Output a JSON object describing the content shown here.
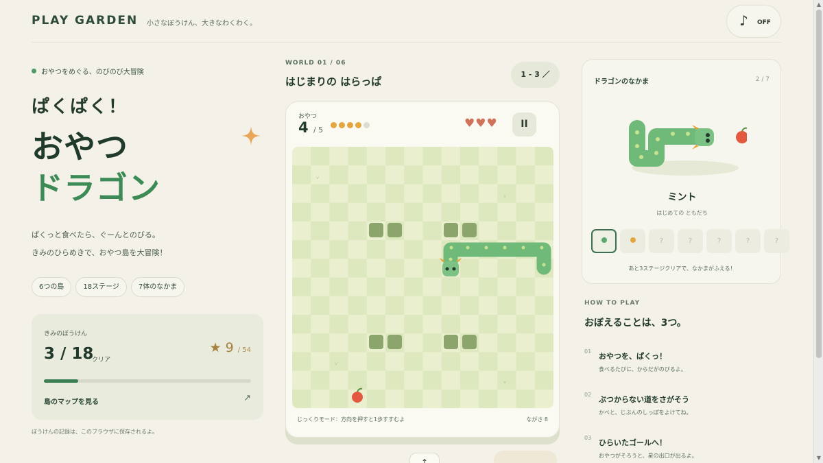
{
  "header": {
    "brand": "PLAY GARDEN",
    "tagline": "小さなぼうけん、大きなわくわく。",
    "sound_label": "OFF",
    "sound_icon": "music-note-icon"
  },
  "hero": {
    "lead": "おやつをめぐる、のびのび大冒険",
    "title_small": "ぱくぱく！",
    "title_line1": "おやつ",
    "title_line2": "ドラゴン",
    "desc_line1": "ぱくっと食べたら、ぐーんとのびる。",
    "desc_line2": "きみのひらめきで、おやつ島を大冒険！",
    "pills": [
      "6つの島",
      "18ステージ",
      "7体のなかま"
    ]
  },
  "progress": {
    "label": "きみのぼうけん",
    "cleared": "3 / 18",
    "cleared_value": 3,
    "cleared_total": 18,
    "clear_word": "クリア",
    "stars": "9",
    "stars_total": "/ 54",
    "map_link": "島のマップを見る",
    "save_note": "ぼうけんの記録は、このブラウザに保存されるよ。"
  },
  "game": {
    "world_label": "WORLD 01 / 06",
    "world_title": "はじまりの はらっぱ",
    "stage_button": "1 - 3 ／",
    "snack_label": "おやつ",
    "snack_count": "4",
    "snack_total": "/ 5",
    "snack_progress": [
      true,
      true,
      true,
      true,
      false
    ],
    "lives": "♥♥♥",
    "lives_count": 3,
    "pause_label": "II",
    "mode_note": "じっくりモード：方向を押すと1歩すすむよ",
    "length_note": "ながさ 8",
    "up_control": "↑",
    "colors": {
      "board_light": "#e9efcf",
      "board_dark": "#dde8bf",
      "snake": "#6fba78",
      "block": "#8ca56c",
      "snack_full": "#e3a640",
      "snack_empty": "#dddccf",
      "heart": "#d0715a"
    }
  },
  "friends": {
    "title": "ドラゴンのなかま",
    "count": "2 / 7",
    "name": "ミント",
    "subtitle": "はじめての ともだち",
    "slots": [
      "",
      "",
      "?",
      "?",
      "?",
      "?",
      "?"
    ],
    "slot_colors": [
      "#5aa86e",
      "#e3a640"
    ],
    "footer": "あと3ステージクリアで、なかまがふえる！"
  },
  "howto": {
    "label": "HOW TO PLAY",
    "title": "おぼえることは、3つ。",
    "steps": [
      {
        "num": "01",
        "title": "おやつを、ぱくっ！",
        "sub": "食べるたびに、からだがのびるよ。"
      },
      {
        "num": "02",
        "title": "ぶつからない道をさがそう",
        "sub": "かべと、じぶんのしっぽをよけてね。"
      },
      {
        "num": "03",
        "title": "ひらいたゴールへ！",
        "sub": "おやつがそろうと、星の出口が出るよ。"
      }
    ]
  }
}
